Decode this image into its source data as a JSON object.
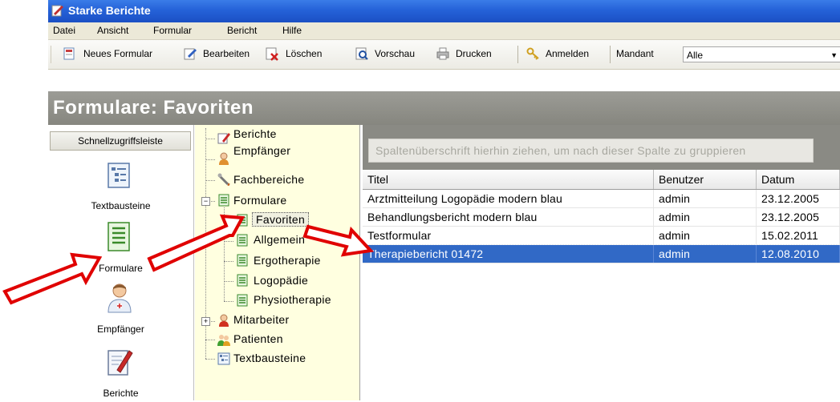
{
  "window": {
    "title": "Starke Berichte"
  },
  "menu": [
    "Datei",
    "Ansicht",
    "Formular",
    "Bericht",
    "Hilfe"
  ],
  "toolbar": {
    "new_form": "Neues Formular",
    "edit": "Bearbeiten",
    "delete": "Löschen",
    "preview": "Vorschau",
    "print": "Drucken",
    "login": "Anmelden",
    "mandant_label": "Mandant",
    "mandant_value": "Alle"
  },
  "page_title": "Formulare: Favoriten",
  "shortcut_bar": {
    "header": "Schnellzugriffsleiste",
    "items": [
      "Textbausteine",
      "Formulare",
      "Empfänger",
      "Berichte"
    ]
  },
  "tree": {
    "berichte": "Berichte",
    "empfaenger": "Empfänger",
    "fachbereiche": "Fachbereiche",
    "formulare": "Formulare",
    "favoriten": "Favoriten",
    "allgemein": "Allgemein",
    "ergotherapie": "Ergotherapie",
    "logopaedie": "Logopädie",
    "physiotherapie": "Physiotherapie",
    "mitarbeiter": "Mitarbeiter",
    "patienten": "Patienten",
    "textbausteine": "Textbausteine"
  },
  "grid": {
    "group_hint": "Spaltenüberschrift hierhin ziehen, um nach dieser Spalte zu gruppieren",
    "columns": [
      "Titel",
      "Benutzer",
      "Datum"
    ],
    "rows": [
      [
        "Arztmitteilung Logopädie modern blau",
        "admin",
        "23.12.2005"
      ],
      [
        "Behandlungsbericht modern blau",
        "admin",
        "23.12.2005"
      ],
      [
        "Testformular",
        "admin",
        "15.02.2011"
      ],
      [
        "Therapiebericht 01472",
        "admin",
        "12.08.2010"
      ]
    ],
    "selected_row": 3
  },
  "colors": {
    "titlebar": "#2562d8",
    "selection": "#3169c6",
    "tree_bg": "#ffffe0",
    "arrow": "#e00000"
  }
}
